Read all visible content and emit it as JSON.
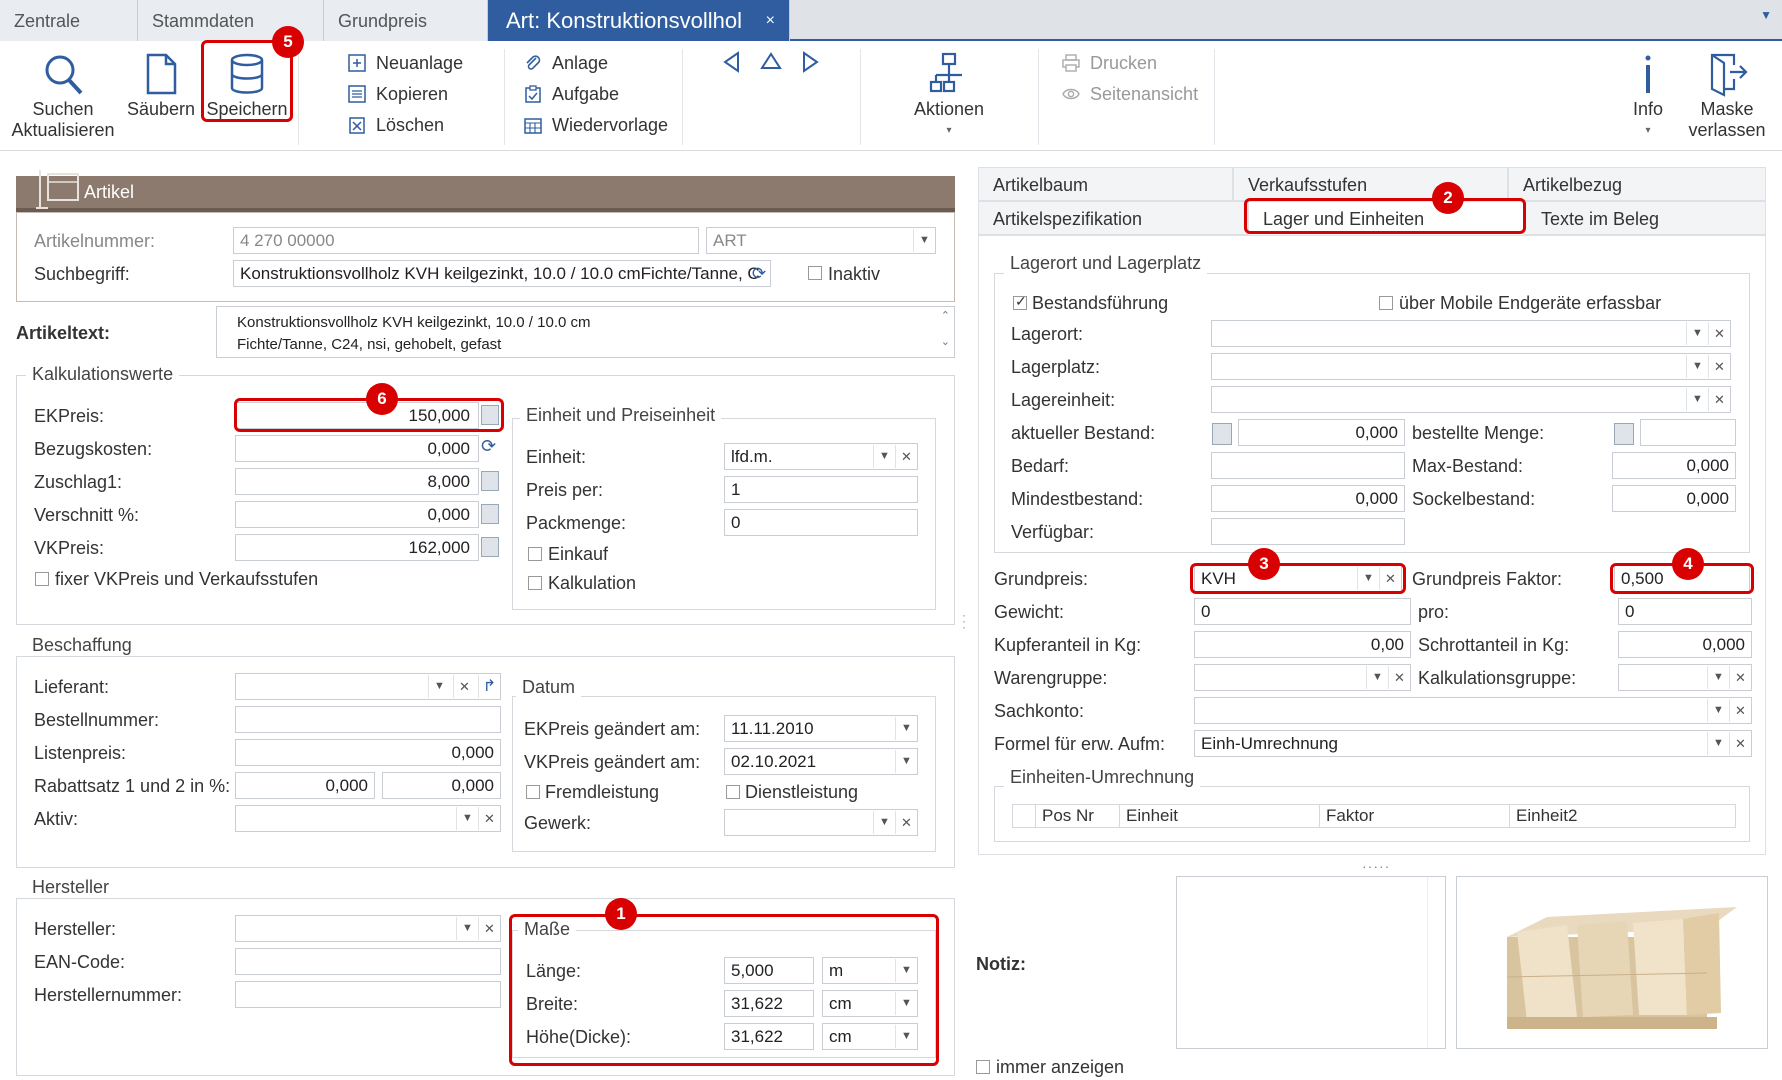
{
  "tabs": [
    "Zentrale",
    "Stammdaten",
    "Grundpreis",
    "Art: Konstruktionsvollhol"
  ],
  "tab_close": "×",
  "toolbar": {
    "suchen": "Suchen",
    "aktualisieren": "Aktualisieren",
    "saeubern": "Säubern",
    "speichern": "Speichern",
    "neuanlage": "Neuanlage",
    "kopieren": "Kopieren",
    "loeschen": "Löschen",
    "anlage": "Anlage",
    "aufgabe": "Aufgabe",
    "wiedervorlage": "Wiedervorlage",
    "aktionen": "Aktionen",
    "drucken": "Drucken",
    "seitenansicht": "Seitenansicht",
    "info": "Info",
    "maske": "Maske",
    "verlassen": "verlassen"
  },
  "artikel": {
    "header": "Artikel",
    "artikelnummer_label": "Artikelnummer:",
    "artikelnummer": "4 270 00000",
    "art": "ART",
    "suchbegriff_label": "Suchbegriff:",
    "suchbegriff": "Konstruktionsvollholz KVH keilgezinkt, 10.0 / 10.0 cmFichte/Tanne, C",
    "inaktiv": "Inaktiv",
    "artikeltext_label": "Artikeltext:",
    "artikeltext_line1": "Konstruktionsvollholz KVH keilgezinkt, 10.0 / 10.0 cm",
    "artikeltext_line2": "Fichte/Tanne, C24, nsi, gehobelt, gefast"
  },
  "kalkulation": {
    "title": "Kalkulationswerte",
    "ekpreis_label": "EKPreis:",
    "ekpreis": "150,000",
    "bezugskosten_label": "Bezugskosten:",
    "bezugskosten": "0,000",
    "zuschlag_label": "Zuschlag1:",
    "zuschlag": "8,000",
    "verschnitt_label": "Verschnitt %:",
    "verschnitt": "0,000",
    "vkpreis_label": "VKPreis:",
    "vkpreis": "162,000",
    "fixer": "fixer VKPreis und Verkaufsstufen"
  },
  "einheit": {
    "title": "Einheit und Preiseinheit",
    "einheit_label": "Einheit:",
    "einheit": "lfd.m.",
    "preisper_label": "Preis per:",
    "preisper": "1",
    "packmenge_label": "Packmenge:",
    "packmenge": "0",
    "einkauf": "Einkauf",
    "kalkulation": "Kalkulation"
  },
  "beschaffung": {
    "title": "Beschaffung",
    "lieferant_label": "Lieferant:",
    "bestellnummer_label": "Bestellnummer:",
    "listenpreis_label": "Listenpreis:",
    "listenpreis": "0,000",
    "rabatt_label": "Rabattsatz 1 und 2 in %:",
    "rabatt1": "0,000",
    "rabatt2": "0,000",
    "aktiv_label": "Aktiv:"
  },
  "datum": {
    "title": "Datum",
    "ek_label": "EKPreis geändert am:",
    "ek": "11.11.2010",
    "vk_label": "VKPreis geändert am:",
    "vk": "02.10.2021",
    "fremd": "Fremdleistung",
    "dienst": "Dienstleistung",
    "gewerk_label": "Gewerk:"
  },
  "hersteller": {
    "title": "Hersteller",
    "hersteller_label": "Hersteller:",
    "ean_label": "EAN-Code:",
    "nummer_label": "Herstellernummer:"
  },
  "masse": {
    "title": "Maße",
    "laenge_label": "Länge:",
    "laenge": "5,000",
    "laenge_unit": "m",
    "breite_label": "Breite:",
    "breite": "31,622",
    "breite_unit": "cm",
    "hoehe_label": "Höhe(Dicke):",
    "hoehe": "31,622",
    "hoehe_unit": "cm"
  },
  "right_tabs": [
    "Artikelbaum",
    "Verkaufsstufen",
    "Artikelbezug",
    "Artikelspezifikation",
    "Lager und Einheiten",
    "Texte im Beleg"
  ],
  "lager": {
    "title": "Lagerort und Lagerplatz",
    "bestandsfuehrung": "Bestandsführung",
    "mobile": "über Mobile Endgeräte erfassbar",
    "lagerort_label": "Lagerort:",
    "lagerplatz_label": "Lagerplatz:",
    "lagereinheit_label": "Lagereinheit:",
    "bestand_label": "aktueller Bestand:",
    "bestand": "0,000",
    "bestellt_label": "bestellte Menge:",
    "bedarf_label": "Bedarf:",
    "maxbestand_label": "Max-Bestand:",
    "maxbestand": "0,000",
    "mindest_label": "Mindestbestand:",
    "mindest": "0,000",
    "sockel_label": "Sockelbestand:",
    "sockel": "0,000",
    "verfuegbar_label": "Verfügbar:"
  },
  "grund": {
    "grundpreis_label": "Grundpreis:",
    "grundpreis": "KVH",
    "faktor_label": "Grundpreis Faktor:",
    "faktor": "0,500",
    "gewicht_label": "Gewicht:",
    "gewicht": "0",
    "pro_label": "pro:",
    "pro": "0",
    "kupfer_label": "Kupferanteil in Kg:",
    "kupfer": "0,00",
    "schrott_label": "Schrottanteil in Kg:",
    "schrott": "0,000",
    "warengruppe_label": "Warengruppe:",
    "kalkgruppe_label": "Kalkulationsgruppe:",
    "sachkonto_label": "Sachkonto:",
    "formel_label": "Formel für erw. Aufm:",
    "formel": "Einh-Umrechnung",
    "umrechnung_title": "Einheiten-Umrechnung",
    "cols": [
      "Pos Nr",
      "Einheit",
      "Faktor",
      "Einheit2"
    ]
  },
  "notiz": {
    "label": "Notiz:",
    "immer": "immer anzeigen"
  },
  "badges": [
    "1",
    "2",
    "3",
    "4",
    "5",
    "6"
  ],
  "colors": {
    "accent": "#2f5d9f",
    "callout": "#d80000",
    "header": "#8d7a6e"
  }
}
